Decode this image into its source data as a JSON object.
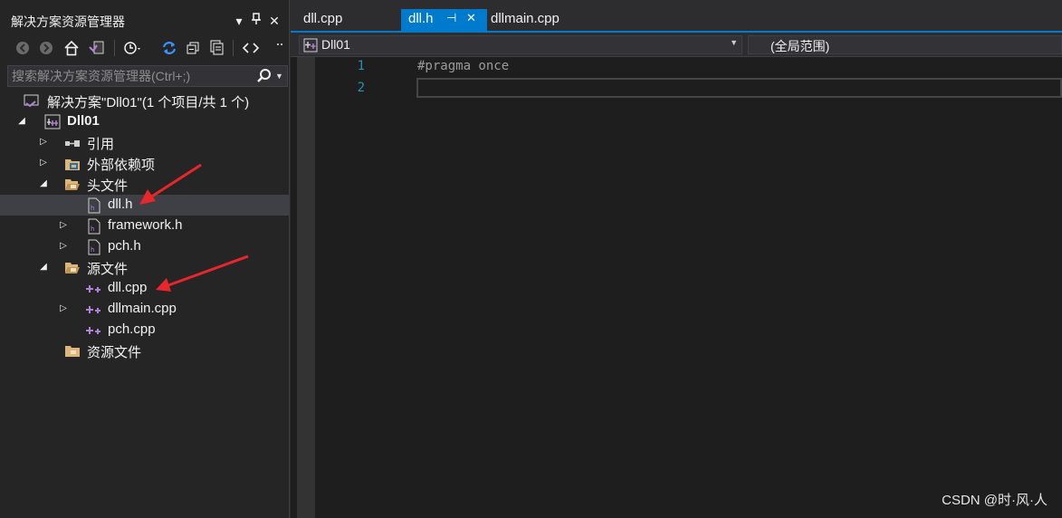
{
  "explorer": {
    "title": "解决方案资源管理器",
    "title_buttons": {
      "dropdown": "▾",
      "pin": "📌",
      "close": "✕"
    },
    "search_placeholder": "搜索解决方案资源管理器(Ctrl+;)",
    "tree": {
      "solution": "解决方案\"Dll01\"(1 个项目/共 1 个)",
      "project": "Dll01",
      "references": "引用",
      "external_deps": "外部依赖项",
      "header_folder": "头文件",
      "dll_h": "dll.h",
      "framework_h": "framework.h",
      "pch_h": "pch.h",
      "source_folder": "源文件",
      "dll_cpp": "dll.cpp",
      "dllmain_cpp": "dllmain.cpp",
      "pch_cpp": "pch.cpp",
      "resource_folder": "资源文件"
    }
  },
  "tabs": [
    "dll.cpp",
    "dll.h",
    "dllmain.cpp"
  ],
  "active_tab_pin": "⊣",
  "active_tab_close": "✕",
  "navbar": {
    "project": "Dll01",
    "scope": "(全局范围)"
  },
  "editor": {
    "lines": [
      {
        "number": "1",
        "text": "#pragma once"
      },
      {
        "number": "2",
        "text": ""
      }
    ]
  },
  "watermark": "CSDN @时·风·人",
  "colors": {
    "accent": "#007acc",
    "arrow": "#e8262c",
    "line_number": "#2b91af"
  }
}
